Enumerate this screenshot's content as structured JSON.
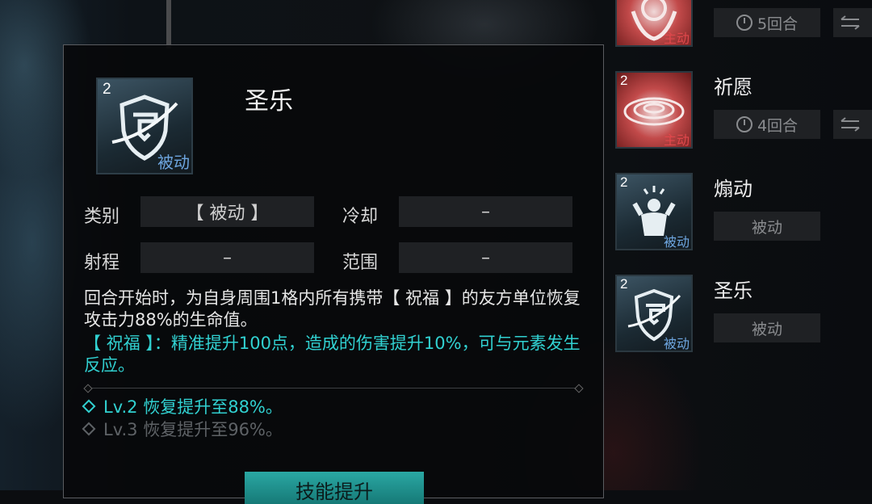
{
  "detail": {
    "level": "2",
    "type_tag": "被动",
    "name": "圣乐",
    "attrs": {
      "category_label": "类别",
      "category_value": "【 被动 】",
      "cooldown_label": "冷却",
      "cooldown_value": "–",
      "range_label": "射程",
      "range_value": "–",
      "area_label": "范围",
      "area_value": "–"
    },
    "description": "回合开始时，为自身周围1格内所有携带【 祝福 】的友方单位恢复攻击力88%的生命值。",
    "blessing_note": "【 祝福 】：精准提升100点，造成的伤害提升10%，可与元素发生反应。",
    "levels": [
      {
        "text": "Lv.2 恢复提升至88%。",
        "state": "active"
      },
      {
        "text": "Lv.3 恢复提升至96%。",
        "state": "inactive"
      }
    ],
    "upgrade_button": "技能提升"
  },
  "skill_list": [
    {
      "name": "",
      "level": "",
      "tag": "主动",
      "tag_color": "red",
      "cooldown": "5回合"
    },
    {
      "name": "祈愿",
      "level": "2",
      "tag": "主动",
      "tag_color": "red",
      "cooldown": "4回合"
    },
    {
      "name": "煽动",
      "level": "2",
      "tag": "被动",
      "tag_color": "blue",
      "passive_label": "被动"
    },
    {
      "name": "圣乐",
      "level": "2",
      "tag": "被动",
      "tag_color": "blue",
      "passive_label": "被动"
    }
  ],
  "colors": {
    "accent_teal": "#31d1d1",
    "passive_blue": "#6ea6e0",
    "active_red": "#e0484c",
    "button": "#1f9a96"
  }
}
